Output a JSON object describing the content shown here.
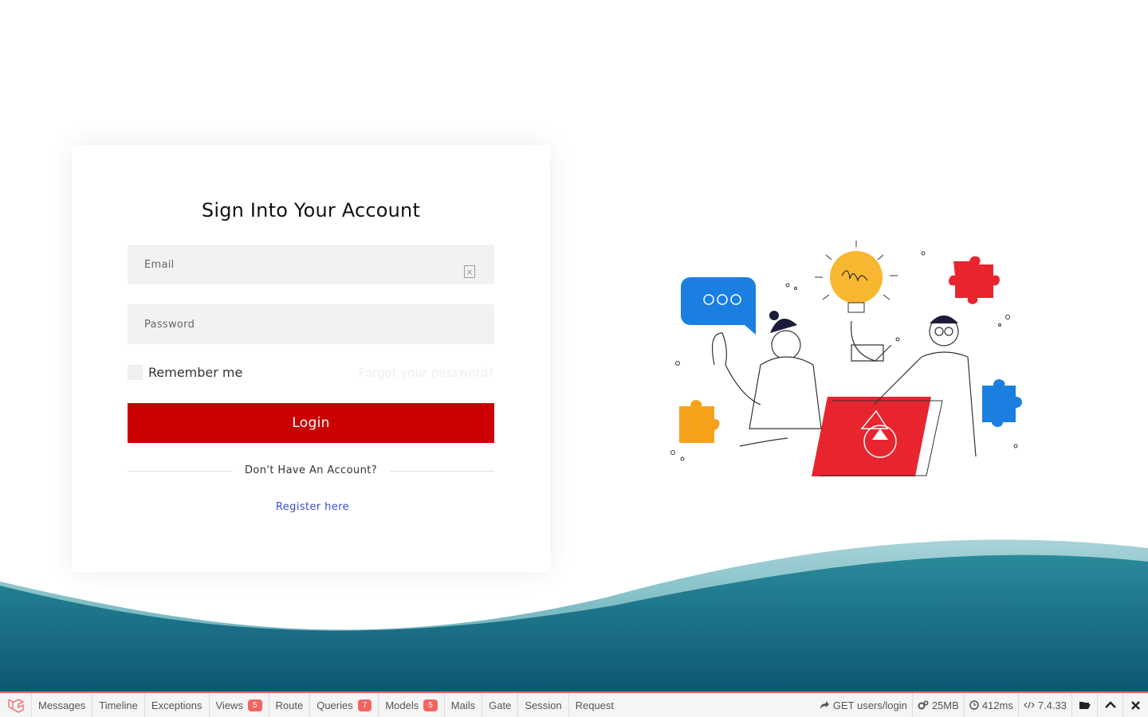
{
  "login": {
    "title": "Sign Into Your Account",
    "email_placeholder": "Email",
    "password_placeholder": "Password",
    "remember_label": "Remember me",
    "forgot_link": "Forgot your password?",
    "login_button": "Login",
    "no_account_text": "Don't Have An Account?",
    "register_link": "Register here"
  },
  "colors": {
    "primary_button": "#cc0000",
    "link": "#3d4bd1",
    "wave_dark": "#0f5e75",
    "debugbar_accent": "#f4645f"
  },
  "debugbar": {
    "tabs": [
      {
        "label": "Messages"
      },
      {
        "label": "Timeline"
      },
      {
        "label": "Exceptions"
      },
      {
        "label": "Views",
        "badge": "5"
      },
      {
        "label": "Route"
      },
      {
        "label": "Queries",
        "badge": "7"
      },
      {
        "label": "Models",
        "badge": "5"
      },
      {
        "label": "Mails"
      },
      {
        "label": "Gate"
      },
      {
        "label": "Session"
      },
      {
        "label": "Request"
      }
    ],
    "request": "GET users/login",
    "memory": "25MB",
    "time": "412ms",
    "php_version": "7.4.33",
    "icons": [
      "laravel-logo-icon",
      "share-icon",
      "cogs-icon",
      "clock-icon",
      "code-icon",
      "folder-open-icon",
      "chevron-up-icon",
      "close-icon"
    ]
  }
}
